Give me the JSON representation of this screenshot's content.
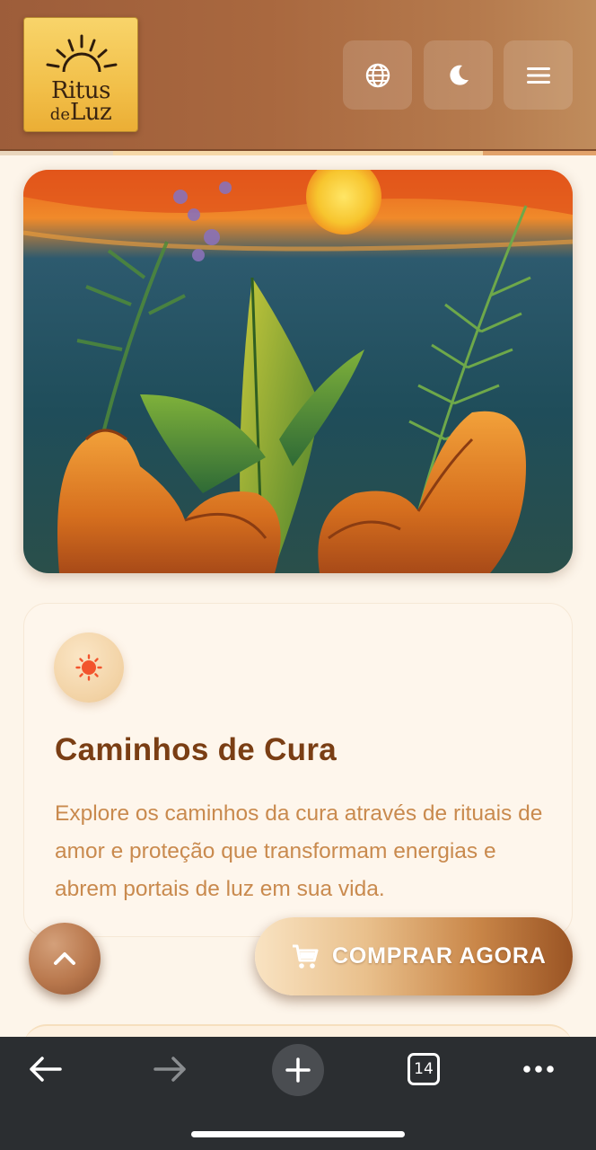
{
  "header": {
    "logo": {
      "line1": "Ritus",
      "line2_small": "de",
      "line2_big": "Luz"
    },
    "buttons": [
      {
        "name": "language",
        "icon": "globe-icon"
      },
      {
        "name": "theme",
        "icon": "moon-icon"
      },
      {
        "name": "menu",
        "icon": "hamburger-menu-icon"
      }
    ]
  },
  "hero": {
    "icon": "herbs-in-hands-painting"
  },
  "card": {
    "icon": "sun-icon",
    "title": "Caminhos de Cura",
    "text": "Explore os caminhos da cura através de rituais de amor e proteção que transformam energias e abrem portais de luz em sua vida."
  },
  "actions": {
    "scroll_top_icon": "chevron-up-icon",
    "buy_label": "COMPRAR AGORA",
    "buy_icon": "cart-icon"
  },
  "browser": {
    "tab_count": "14",
    "icons": [
      "back-arrow-icon",
      "forward-arrow-icon",
      "plus-icon",
      "tabs-icon",
      "more-icon"
    ]
  },
  "colors": {
    "header_bg": "#a9683f",
    "logo_bg": "#f2c04a",
    "title": "#7a3e14",
    "body_text": "#c98a4e",
    "page_bg": "#fdf5ea",
    "browser_bar": "#2b2e31"
  }
}
